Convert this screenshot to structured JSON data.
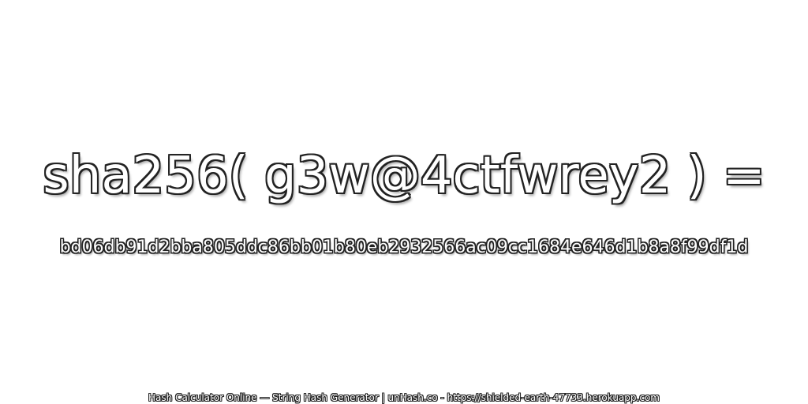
{
  "expression": "sha256( g3w@4ctfwrey2 ) =",
  "hash": "bd06db91d2bba805ddc86bb01b80eb2932566ac09cc1684e646d1b8a8f99df1d",
  "footer": "Hash Calculator Online — String Hash Generator | unHash.co - https://shielded-earth-47733.herokuapp.com",
  "colors": {
    "background": "#ffffff",
    "text_fill": "#ffffff",
    "text_outline": "#222222"
  }
}
